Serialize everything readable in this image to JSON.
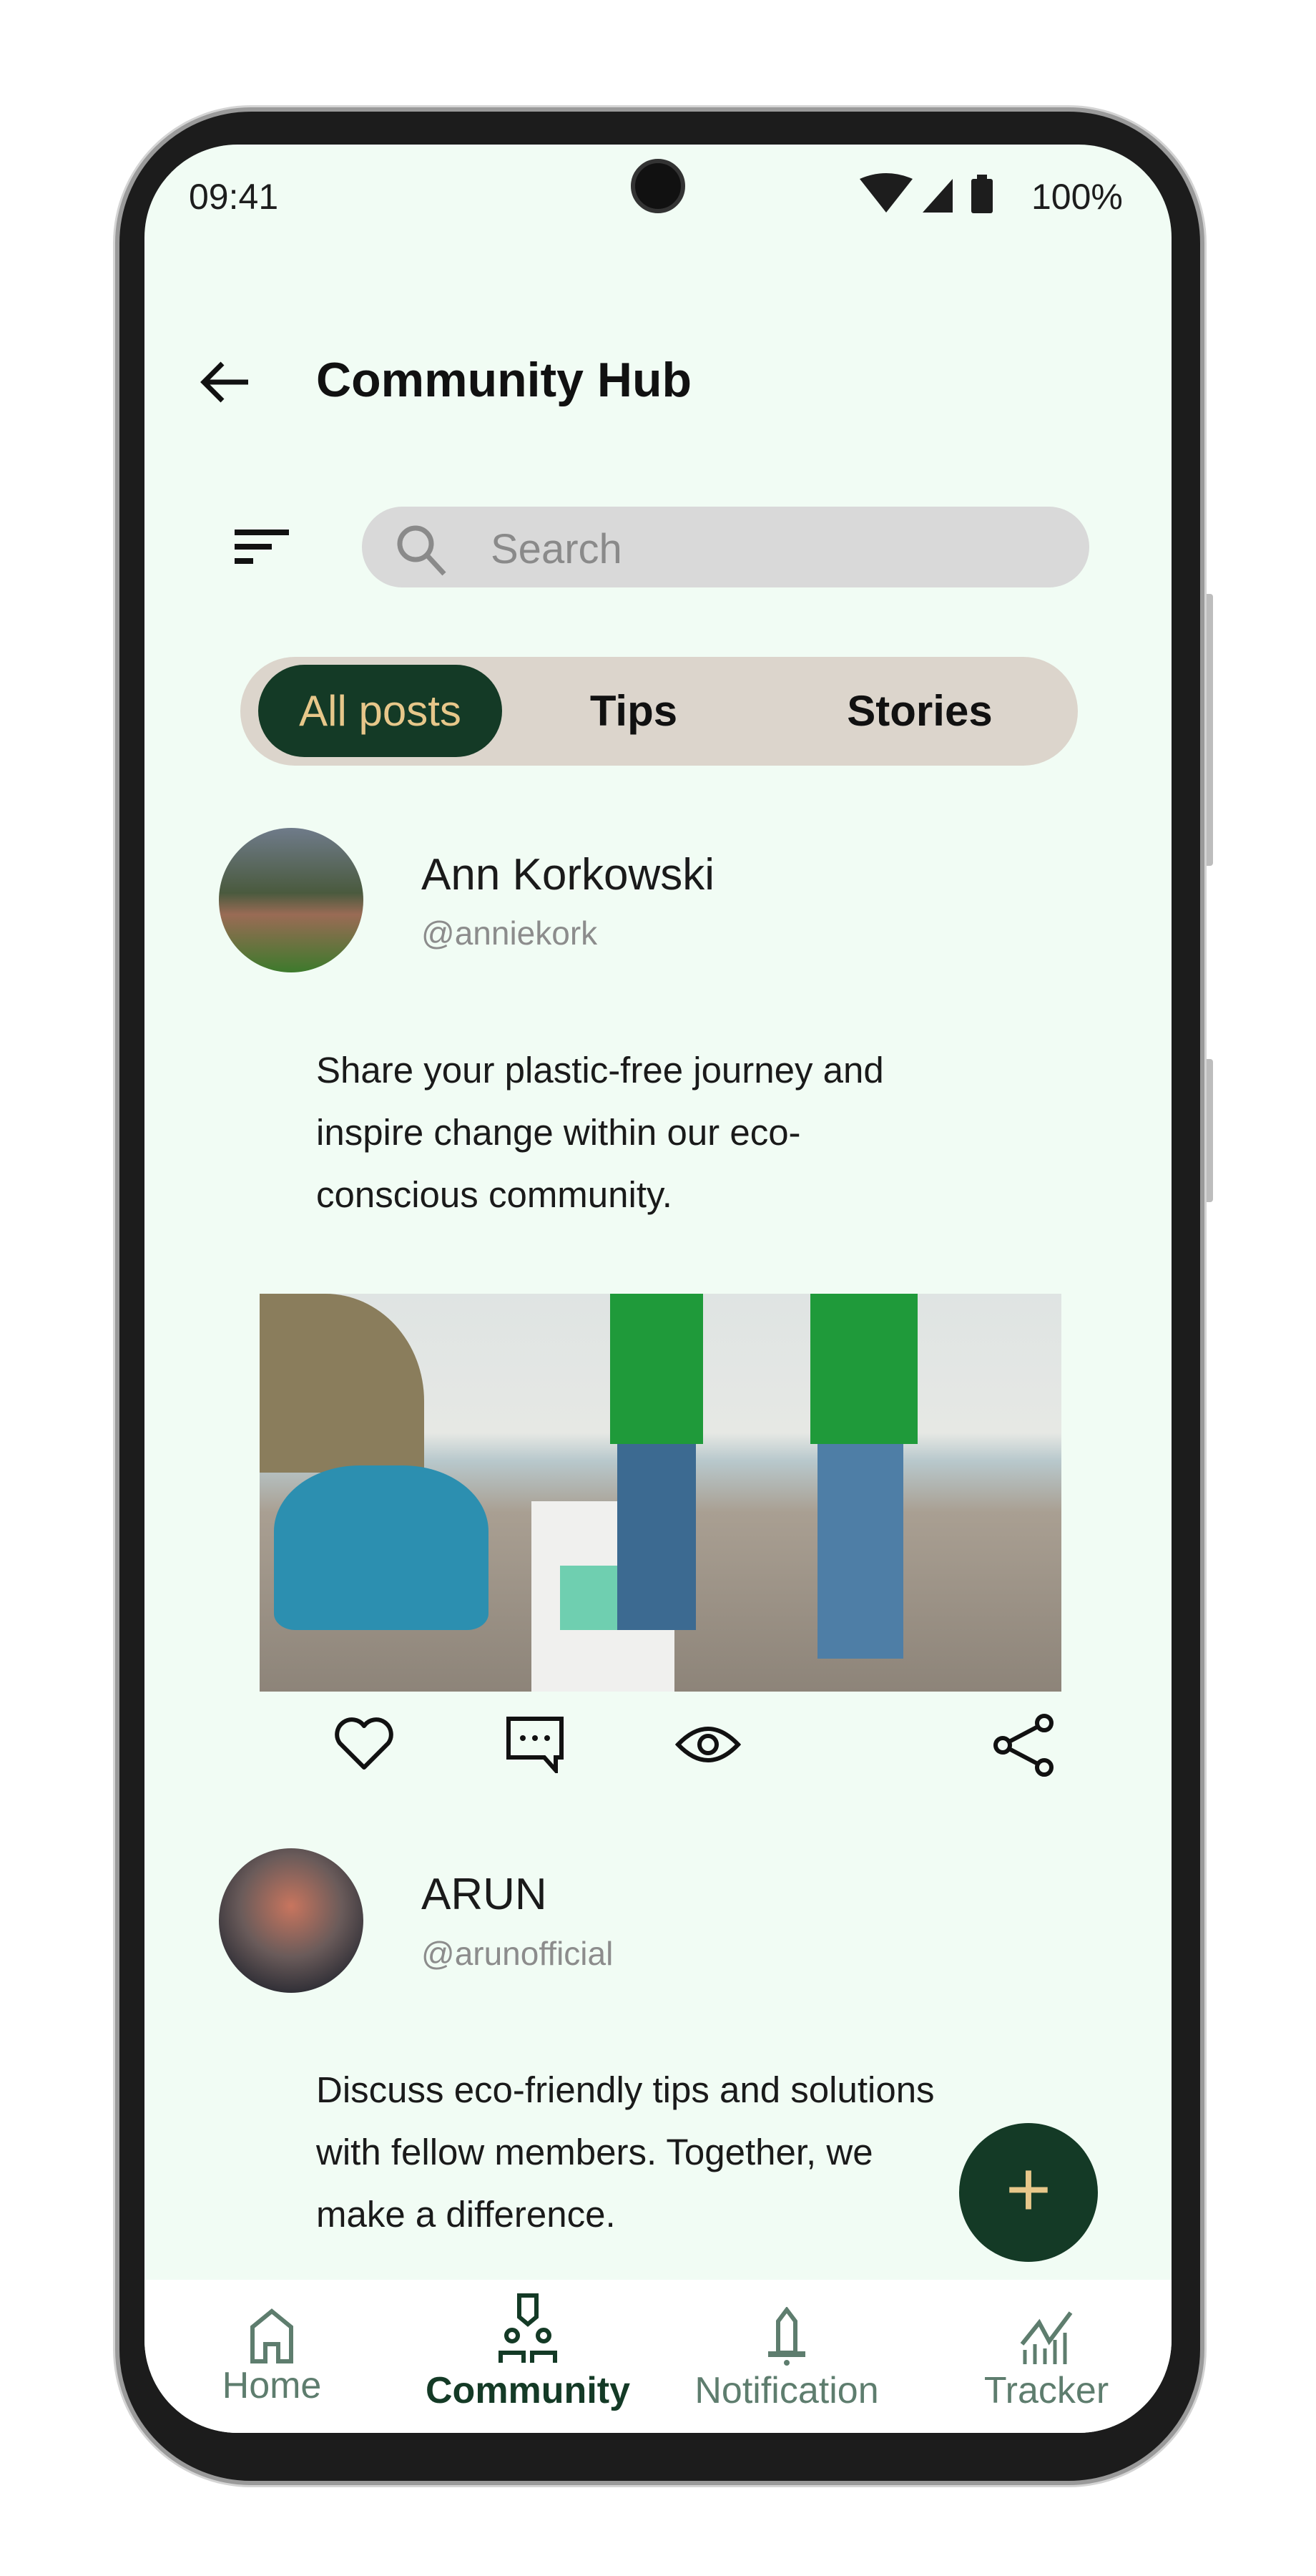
{
  "status_bar": {
    "time": "09:41",
    "battery": "100%"
  },
  "header": {
    "title": "Community Hub"
  },
  "search": {
    "placeholder": "Search"
  },
  "tabs": [
    {
      "label": "All posts",
      "active": true
    },
    {
      "label": "Tips"
    },
    {
      "label": "Stories"
    }
  ],
  "posts": [
    {
      "name": "Ann Korkowski",
      "handle": "@anniekork",
      "lines": [
        "Share your plastic-free journey and",
        "inspire change within our eco-",
        "conscious community."
      ]
    },
    {
      "name": "ARUN",
      "handle": "@arunofficial",
      "lines": [
        "Discuss eco-friendly tips and solutions",
        "with fellow members. Together, we",
        "make a difference."
      ]
    }
  ],
  "fab": {
    "label": "+"
  },
  "nav": [
    {
      "label": "Home",
      "icon": "home-icon"
    },
    {
      "label": "Community",
      "icon": "community-icon",
      "active": true
    },
    {
      "label": "Notification",
      "icon": "bell-icon"
    },
    {
      "label": "Tracker",
      "icon": "chart-icon"
    }
  ],
  "colors": {
    "accent": "#143a26",
    "accent_text": "#e7c78a",
    "background": "#f1fcf4",
    "nav_inactive": "#5e7d6e"
  }
}
